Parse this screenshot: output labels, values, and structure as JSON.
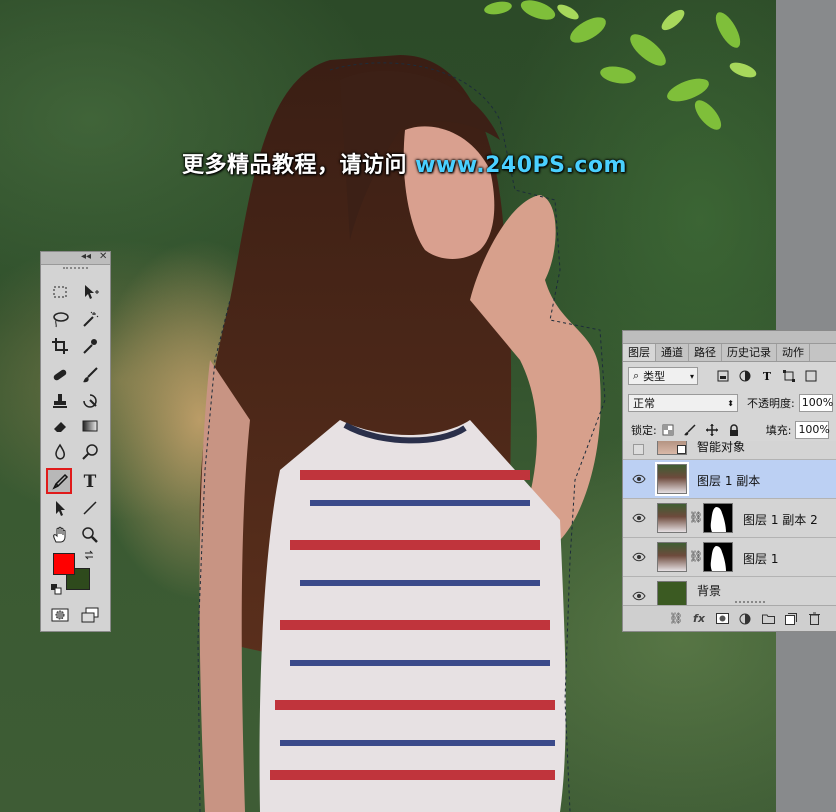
{
  "watermark": {
    "prefix": "更多精品教程，请访问 ",
    "url": "www.240PS.com"
  },
  "colors": {
    "foreground": "#ff0000",
    "background": "#2e4a1c",
    "highlight": "#e01a1a",
    "selected_layer": "#bcd0f3"
  },
  "tools_panel": {
    "title_controls": "◂◂ ✕",
    "icons": [
      "marquee-icon",
      "move-icon",
      "lasso-icon",
      "magic-wand-icon",
      "crop-icon",
      "eyedropper-icon",
      "healing-brush-icon",
      "brush-icon",
      "clone-stamp-icon",
      "history-brush-icon",
      "eraser-icon",
      "gradient-icon",
      "blur-icon",
      "dodge-icon",
      "pen-icon",
      "type-icon",
      "path-selection-icon",
      "line-icon",
      "hand-icon",
      "zoom-icon",
      "quick-mask-icon",
      "screen-mode-icon"
    ],
    "type_tool_label": "T"
  },
  "layers_panel": {
    "tabs": [
      "图层",
      "通道",
      "路径",
      "历史记录",
      "动作"
    ],
    "filter": {
      "kind_label": "类型"
    },
    "blend_mode": "正常",
    "opacity_label": "不透明度:",
    "opacity_value": "100%",
    "lock_label": "锁定:",
    "fill_label": "填充:",
    "fill_value": "100%",
    "layers": [
      {
        "name": "智能对象",
        "visible": false,
        "selected": false
      },
      {
        "name": "图层 1 副本",
        "visible": true,
        "selected": true
      },
      {
        "name": "图层 1 副本 2",
        "visible": true,
        "selected": false
      },
      {
        "name": "图层 1",
        "visible": true,
        "selected": false
      },
      {
        "name": "背景",
        "visible": true,
        "selected": false
      }
    ],
    "footer_fx": "fx"
  }
}
